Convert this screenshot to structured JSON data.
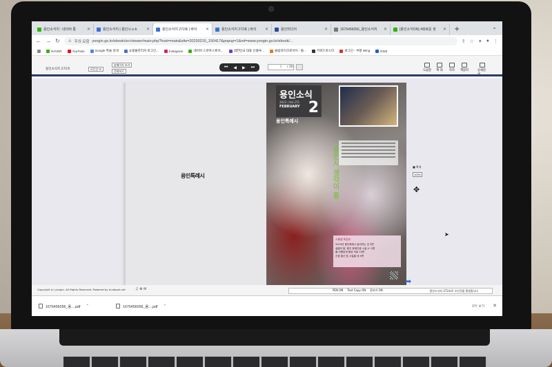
{
  "browser": {
    "tabs": [
      {
        "label": "용인소식지 : 네이버 통",
        "color": "#2db400",
        "active": false
      },
      {
        "label": "용인소식지 | 용인시 e-b",
        "color": "#3b6fd6",
        "active": false
      },
      {
        "label": "용인소식지 272호 | 바이",
        "color": "#3b6fd6",
        "active": true
      },
      {
        "label": "용인소식지 272호 | 바이",
        "color": "#3b6fd6",
        "active": false
      },
      {
        "label": "용인미디어",
        "color": "#2b4a9b",
        "active": false
      },
      {
        "label": "1676456056_용인소식지",
        "color": "#777777",
        "active": false
      },
      {
        "label": "[용인소식ON] 4화로운 생",
        "color": "#2db400",
        "active": false
      }
    ],
    "new_tab": "+",
    "insecure_label": "주의 요함",
    "url": "yongin.go.kr/ebook/src/viewer/main.php?host=main&site=20230215_150417&popup=1&ref=www.yongin.go.kr/ebook/...",
    "bookmarks": [
      {
        "label": "NAVER",
        "color": "#2db400"
      },
      {
        "label": "YouTube",
        "color": "#ff0000"
      },
      {
        "label": "Google 학술 검색",
        "color": "#4285f4"
      },
      {
        "label": "쇼핑몰관리자 로그인...",
        "color": "#4a6fd4"
      },
      {
        "label": "Instagram",
        "color": "#d6246e"
      },
      {
        "label": "네이버 스마트스토어...",
        "color": "#2db400"
      },
      {
        "label": "대한민국 대표 인플루...",
        "color": "#6b3fd4"
      },
      {
        "label": "클립마이크로아이 - 통...",
        "color": "#e07a1f"
      },
      {
        "label": "키워드마스터",
        "color": "#333333"
      },
      {
        "label": "로그인 - 쿠팡 Wing",
        "color": "#e0301e"
      },
      {
        "label": "ESM",
        "color": "#1f5fd4"
      }
    ]
  },
  "viewer": {
    "title": "용인소식지 272호",
    "btn_full": "모든빈 보",
    "btn_fit": "낱페이지 보기",
    "btn_spread": "전체보기",
    "pager": [
      "⏮",
      "◀",
      "▶",
      "⏭"
    ],
    "page_current": "1",
    "page_total": "/ 20",
    "tools": [
      {
        "label": "도움말"
      },
      {
        "label": "확 대"
      },
      {
        "label": "목차"
      },
      {
        "label": "책갈피"
      },
      {
        "label": "상세검색"
      }
    ],
    "left_logo": "용인특례시",
    "cover": {
      "name": "용인소식",
      "issue": "2023 | Vol.272",
      "month": "FEBRUARY",
      "number": "2",
      "brand": "용인특례시",
      "vertical_text": "용인시 생각이 통",
      "pink_head": "스페셜 특집호",
      "pink_lines": [
        "2023년 용인특례시 달라지는 것 3면",
        "설렘의 봄, 용인 문화관광 시설 4~5면",
        "물 아름답게 풍성 의료 10면",
        "신경 통신 등 시설을 대 5면"
      ]
    },
    "side_zoom_label": "■ 확대",
    "side_zoom_value": "100%",
    "footer_text": "Copyright (c) yongin. All Rights Reserved. Powered by ai-ebook.net",
    "status_options": [
      "PEN ON",
      "Text Copy ON",
      "돋보기 ON"
    ],
    "status_message": "용인소식지 272호로 오신것을 환영합니다"
  },
  "downloads": {
    "items": [
      {
        "name": "1676456056_용....pdf"
      },
      {
        "name": "1676456056_용....pdf"
      }
    ],
    "show_all": "모두 보기"
  }
}
